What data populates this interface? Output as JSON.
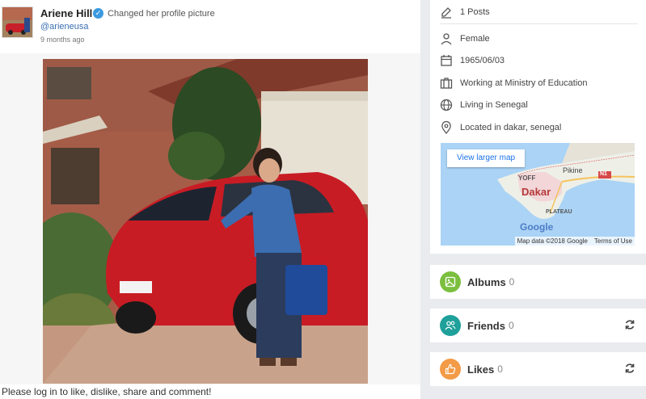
{
  "post": {
    "author": "Ariene Hill",
    "action": "Changed her profile picture",
    "handle": "@arieneusa",
    "time": "9 months ago",
    "footer": "Please log in to like, dislike, share and comment!"
  },
  "about": {
    "posts": "1 Posts",
    "gender": "Female",
    "birthdate": "1965/06/03",
    "work": "Working at Ministry of Education",
    "living": "Living in Senegal",
    "located": "Located in dakar, senegal"
  },
  "map": {
    "button": "View larger map",
    "labels": {
      "yoff": "YOFF",
      "pikine": "Pikine",
      "dakar": "Dakar",
      "plateau": "PLATEAU",
      "n1": "N1",
      "google": "Google"
    },
    "data": "Map data ©2018 Google",
    "terms": "Terms of Use"
  },
  "sidebar": {
    "albums": {
      "label": "Albums",
      "count": "0",
      "color": "#7cbf3f"
    },
    "friends": {
      "label": "Friends",
      "count": "0",
      "color": "#1fa09a"
    },
    "likes": {
      "label": "Likes",
      "count": "0",
      "color": "#f39b47"
    }
  }
}
